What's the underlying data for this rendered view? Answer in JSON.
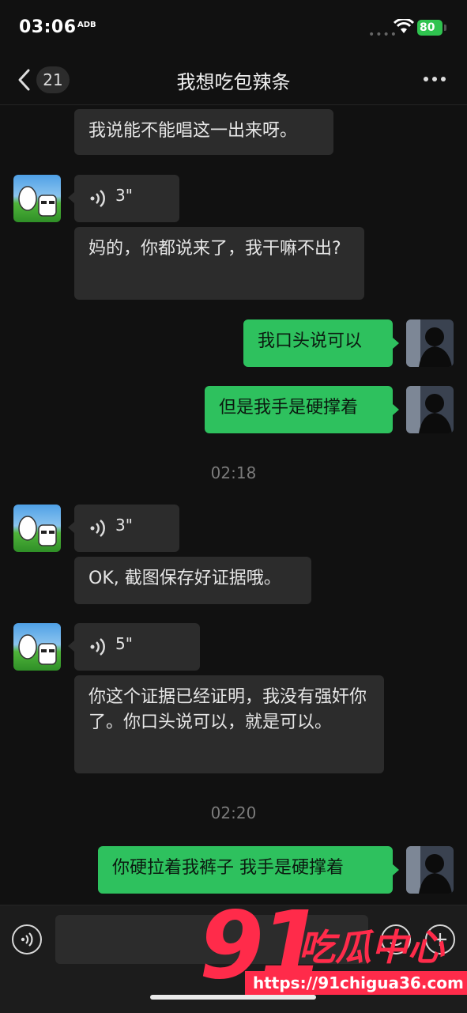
{
  "status_bar": {
    "time": "03:06",
    "sub_icon_text": "ADB",
    "battery": "80"
  },
  "header": {
    "unread_count": "21",
    "title": "我想吃包辣条"
  },
  "messages": {
    "m0_text": "我说能不能唱这一出来呀。",
    "v1_duration": "3\"",
    "m2_text": "妈的，你都说来了，我干嘛不出?",
    "m3_text": "我口头说可以",
    "m4_text": "但是我手是硬撑着",
    "t1": "02:18",
    "v5_duration": "3\"",
    "m6_text": "OK, 截图保存好证据哦。",
    "v7_duration": "5\"",
    "m8_text": "你这个证据已经证明，我没有强奸你了。你口头说可以，就是可以。",
    "t2": "02:20",
    "m9_text": "你硬拉着我裤子 我手是硬撑着"
  },
  "input_bar": {
    "value": ""
  },
  "watermark": {
    "big": "91",
    "cn": "吃瓜中心",
    "url": "https://91chigua36.com"
  },
  "colors": {
    "self_bubble": "#2ec15e",
    "other_bubble": "#2c2c2c",
    "background": "#111111",
    "watermark": "#ff2b4a"
  }
}
